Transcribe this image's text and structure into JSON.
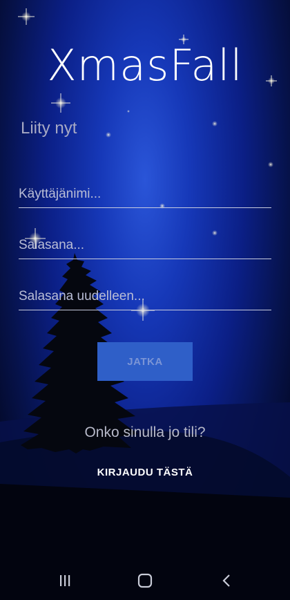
{
  "app": {
    "title": "XmasFall",
    "subtitle": "Liity nyt"
  },
  "form": {
    "username_placeholder": "Käyttäjänimi...",
    "password_placeholder": "Salasana...",
    "password_repeat_placeholder": "Salasana uudelleen...",
    "continue_label": "JATKA"
  },
  "footer": {
    "account_question": "Onko sinulla jo tili?",
    "login_link": "KIRJAUDU TÄSTÄ"
  },
  "navbar": {
    "recent_icon": "recent-apps-icon",
    "home_icon": "home-icon",
    "back_icon": "back-icon"
  },
  "colors": {
    "background_center": "#2a55d8",
    "background_edge": "#030720",
    "button": "#2f5fc8",
    "button_text": "#7b95d6",
    "subtitle": "#a7a9c4"
  }
}
